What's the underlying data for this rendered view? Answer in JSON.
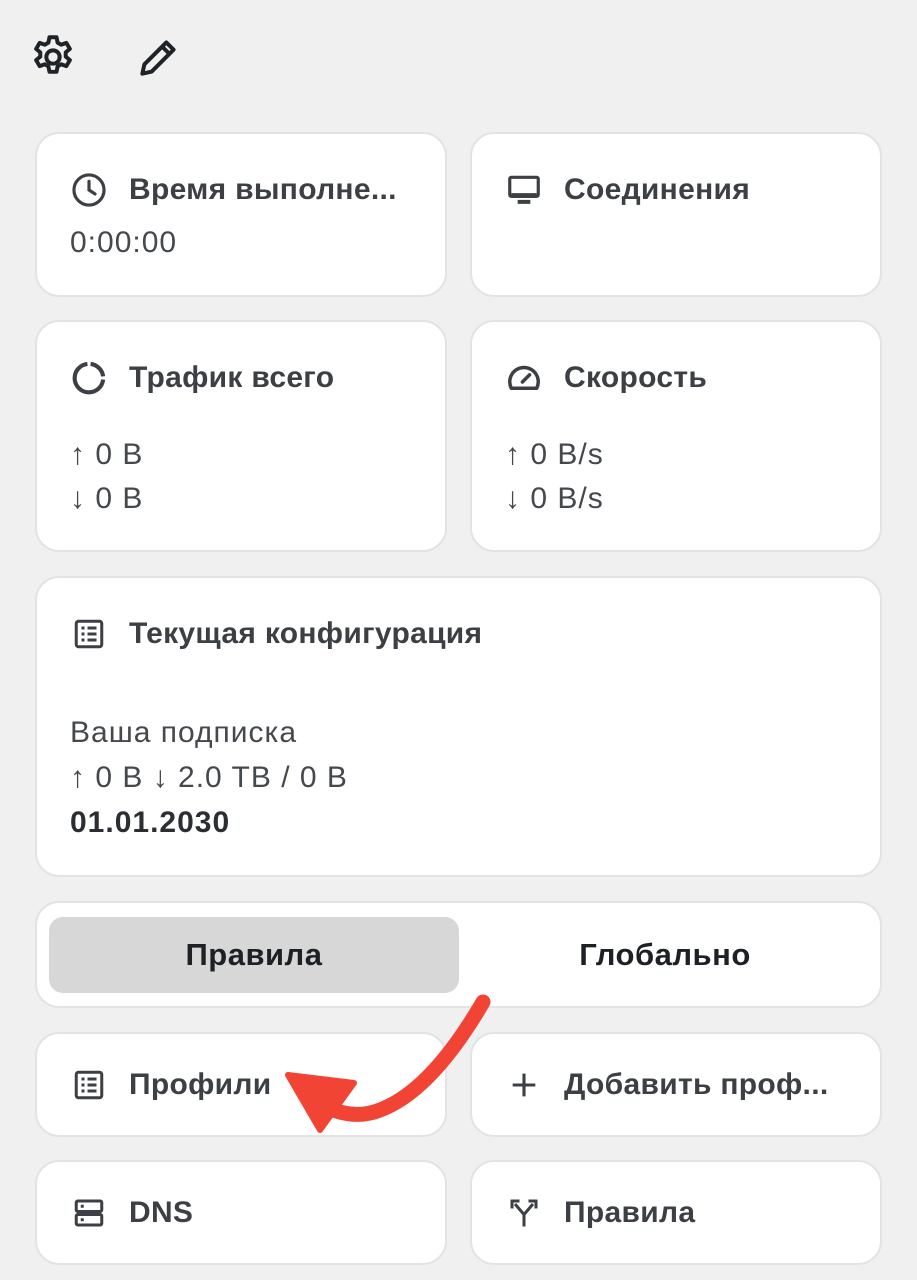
{
  "toolbar": {
    "settings_icon": "gear-icon",
    "edit_icon": "pencil-icon"
  },
  "uptime": {
    "title": "Время выполне...",
    "value": "0:00:00",
    "icon": "clock-icon"
  },
  "connections": {
    "title": "Соединения",
    "icon": "monitor-icon"
  },
  "traffic": {
    "title": "Трафик всего",
    "up": "↑ 0 B",
    "down": "↓ 0 B",
    "icon": "donut-icon"
  },
  "speed": {
    "title": "Скорость",
    "up": "↑ 0 B/s",
    "down": "↓ 0 B/s",
    "icon": "speedometer-icon"
  },
  "config": {
    "title": "Текущая конфигурация",
    "subscription_name": "Ваша подписка",
    "usage": "↑ 0 B ↓ 2.0 TB / 0 B",
    "expiry": "01.01.2030",
    "icon": "list-icon"
  },
  "mode": {
    "options": [
      "Правила",
      "Глобально"
    ],
    "selected": "Правила"
  },
  "tiles": {
    "profiles": "Профили",
    "add_profile": "Добавить проф...",
    "dns": "DNS",
    "rules": "Правила"
  },
  "colors": {
    "background": "#f0f0f0",
    "card": "#ffffff",
    "segment_active": "#d7d7d7",
    "annotation_arrow": "#f24435"
  }
}
